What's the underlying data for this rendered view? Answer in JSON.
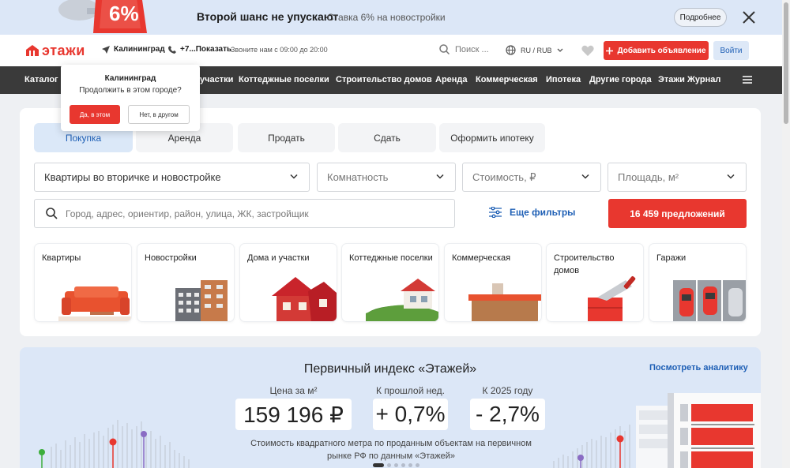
{
  "promo": {
    "badge": "6%",
    "title": "Второй шанс не упускают",
    "subtitle": "Ставка 6% на новостройки",
    "more_label": "Подробнее",
    "close_icon": "close-icon"
  },
  "header": {
    "logo_text": "этажи",
    "city": "Калининград",
    "phone": "+7...Показать",
    "hours": "Звоните нам с 09:00 до 20:00",
    "search_placeholder": "Поиск ...",
    "lang": "RU / RUB",
    "add_label": "Добавить объявление",
    "login_label": "Войти"
  },
  "nav": {
    "items": [
      "Каталог",
      "участки",
      "Коттеджные поселки",
      "Строительство домов",
      "Аренда",
      "Коммерческая",
      "Ипотека",
      "Другие города",
      "Этажи Журнал"
    ]
  },
  "city_popup": {
    "city": "Калининград",
    "question": "Продолжить в этом городе?",
    "yes": "Да, в этом",
    "no": "Нет, в другом"
  },
  "search": {
    "tabs": [
      "Покупка",
      "Аренда",
      "Продать",
      "Сдать",
      "Оформить ипотеку"
    ],
    "active_tab": "Покупка",
    "type_value": "Квартиры во вторичке и новостройке",
    "rooms_placeholder": "Комнатность",
    "price_placeholder": "Стоимость, ₽",
    "area_placeholder": "Площадь, м²",
    "address_placeholder": "Город, адрес, ориентир, район, улица, ЖК, застройщик",
    "more_filters": "Еще фильтры",
    "offers_button": "16 459 предложений",
    "categories": [
      "Квартиры",
      "Новостройки",
      "Дома и участки",
      "Коттеджные поселки",
      "Коммерческая",
      "Строительство домов",
      "Гаражи"
    ]
  },
  "analytics": {
    "title": "Первичный индекс «Этажей»",
    "link": "Посмотреть аналитику",
    "metrics": [
      {
        "label": "Цена за м²",
        "value": "159 196 ₽"
      },
      {
        "label": "К прошлой нед.",
        "value": "+ 0,7%"
      },
      {
        "label": "К 2025 году",
        "value": "- 2,7%"
      }
    ],
    "note": "Стоимость квадратного метра по проданным объектам на первичном рынке РФ по данным «Этажей»",
    "slides": 6,
    "active_slide": 1
  },
  "colors": {
    "accent": "#e8372f",
    "link": "#1e5fb5",
    "nav_bg": "#3a3a3a",
    "banner_bg": "#dce7f7"
  }
}
